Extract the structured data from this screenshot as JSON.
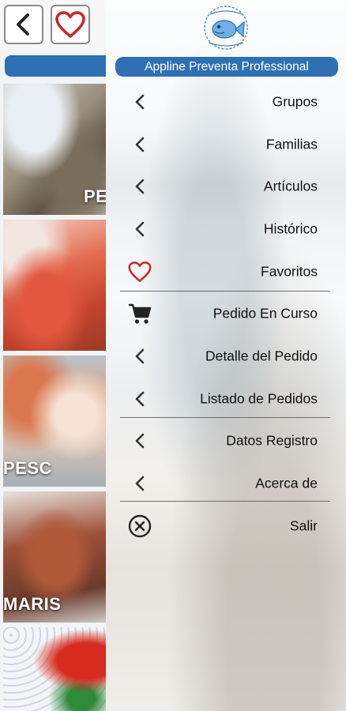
{
  "app": {
    "title": "Appline Preventa Professional"
  },
  "colors": {
    "brand_blue": "#2f6fb3",
    "heart_red": "#d2232a"
  },
  "left_panel": {
    "tiles": [
      {
        "label": "PE"
      },
      {
        "label": ""
      },
      {
        "label": "PESC"
      },
      {
        "label": "MARIS"
      },
      {
        "label": ""
      }
    ]
  },
  "drawer": {
    "menu": [
      {
        "label": "Grupos",
        "icon": "chevron-left-icon"
      },
      {
        "label": "Familias",
        "icon": "chevron-left-icon"
      },
      {
        "label": "Artículos",
        "icon": "chevron-left-icon"
      },
      {
        "label": "Histórico",
        "icon": "chevron-left-icon"
      },
      {
        "label": "Favoritos",
        "icon": "heart-icon"
      },
      {
        "label": "Pedido En Curso",
        "icon": "cart-icon"
      },
      {
        "label": "Detalle del Pedido",
        "icon": "chevron-left-icon"
      },
      {
        "label": "Listado de Pedidos",
        "icon": "chevron-left-icon"
      },
      {
        "label": "Datos Registro",
        "icon": "chevron-left-icon"
      },
      {
        "label": "Acerca de",
        "icon": "chevron-left-icon"
      },
      {
        "label": "Salir",
        "icon": "close-circle-icon"
      }
    ]
  }
}
